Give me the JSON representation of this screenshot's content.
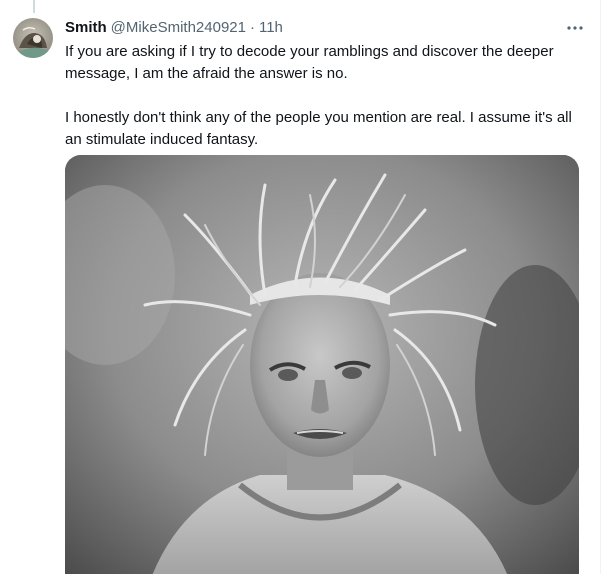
{
  "tweet": {
    "author": {
      "display_name": "Smith",
      "handle": "@MikeSmith240921"
    },
    "separator": "·",
    "time": "11h",
    "paragraphs": [
      "If you are asking if I try to decode your ramblings and discover the deeper message, I am the afraid the answer is no.",
      "I honestly don't think any of the people you mention are real. I assume it's all an stimulate induced fantasy."
    ],
    "more_icon": "more-horizontal-icon",
    "media": {
      "kind": "photo",
      "style": "black-and-white"
    }
  },
  "colors": {
    "primary_text": "#0f1419",
    "secondary_text": "#536471",
    "thread_line": "#cfd9de",
    "border": "#eff3f4"
  }
}
